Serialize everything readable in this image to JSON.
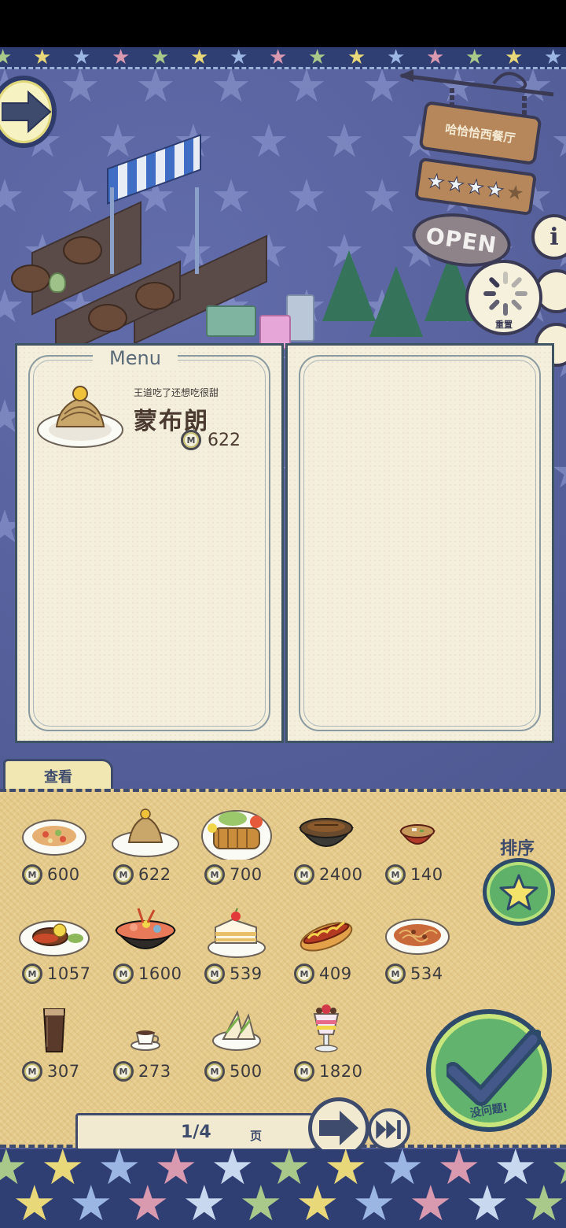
{
  "restaurant": {
    "sign_name": "哈恰恰西餐厅",
    "rating_stars": 4,
    "rating_max": 5,
    "open_sign": "OPEN"
  },
  "controls": {
    "reset_label": "重置",
    "info_label": "i",
    "view_tab": "查看",
    "sort_label": "排序",
    "confirm_label": "没问题!"
  },
  "menu": {
    "title": "Menu",
    "items": [
      {
        "description": "王道吃了还想吃很甜",
        "name": "蒙布朗",
        "price": "622"
      }
    ]
  },
  "dishes": [
    {
      "food": "mixed-salad-plate",
      "price": "600"
    },
    {
      "food": "mont-blanc-plate",
      "price": "622"
    },
    {
      "food": "tonkatsu-plate",
      "price": "700"
    },
    {
      "food": "unagi-bowl",
      "price": "2400"
    },
    {
      "food": "miso-soup-bowl",
      "price": "140"
    },
    {
      "food": "hamburg-steak-plate",
      "price": "1057"
    },
    {
      "food": "seafood-bowl",
      "price": "1600"
    },
    {
      "food": "strawberry-shortcake",
      "price": "539"
    },
    {
      "food": "hot-dog",
      "price": "409"
    },
    {
      "food": "spaghetti-plate",
      "price": "534"
    },
    {
      "food": "iced-coffee-glass",
      "price": "307"
    },
    {
      "food": "coffee-cup",
      "price": "273"
    },
    {
      "food": "sandwich-plate",
      "price": "500"
    },
    {
      "food": "parfait-glass",
      "price": "1820"
    }
  ],
  "pager": {
    "current": "1",
    "separator": "/",
    "total": "4",
    "display": "1/4",
    "unit": "页"
  },
  "colors": {
    "navy": "#3e4b6d",
    "panel": "#e5cb8b",
    "paper": "#f4eedc",
    "green": "#62b36d"
  }
}
